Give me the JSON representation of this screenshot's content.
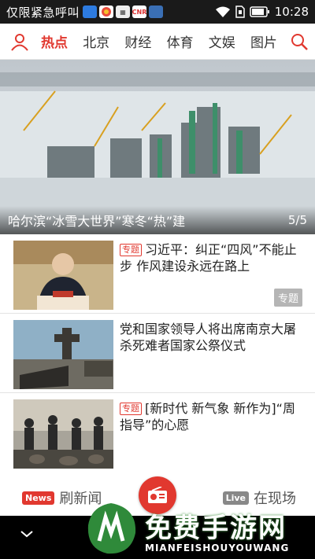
{
  "status_bar": {
    "carrier": "仅限紧急呼叫",
    "time": "10:28",
    "notification_icons": [
      {
        "name": "app-icon-blue",
        "text": "",
        "color": "#2d7be0"
      },
      {
        "name": "app-icon-color",
        "text": "",
        "color": "#e94b3c"
      },
      {
        "name": "app-icon-news",
        "text": "",
        "color": "#444"
      },
      {
        "name": "app-icon-cnr",
        "text": "CNR",
        "color": "#d33"
      },
      {
        "name": "app-icon-msg",
        "text": "",
        "color": "#3a6fb5"
      }
    ],
    "icons": [
      "wifi-icon",
      "sim-icon",
      "battery-icon"
    ]
  },
  "nav": {
    "tabs": [
      {
        "label": "热点",
        "active": true
      },
      {
        "label": "北京",
        "active": false
      },
      {
        "label": "财经",
        "active": false
      },
      {
        "label": "体育",
        "active": false
      },
      {
        "label": "文娱",
        "active": false
      },
      {
        "label": "图片",
        "active": false
      }
    ],
    "accent_color": "#e1382f"
  },
  "hero": {
    "caption": "哈尔滨“冰雪大世界”寒冬“热”建",
    "counter": "5/5"
  },
  "news": [
    {
      "tag": "专题",
      "title": "习近平：纠正“四风”不能止步 作风建设永远在路上",
      "badge": "专题"
    },
    {
      "tag": "",
      "title": "党和国家领导人将出席南京大屠杀死难者国家公祭仪式",
      "badge": ""
    },
    {
      "tag": "专题",
      "title": "[新时代 新气象 新作为]“周指导”的心愿",
      "badge": ""
    }
  ],
  "bottom_bar": {
    "left_pill": "News",
    "left_label": "刷新闻",
    "right_pill": "Live",
    "right_label": "在现场",
    "left_pill_color": "#e1382f",
    "right_pill_color": "#888888"
  },
  "watermark": {
    "title": "免费手游网",
    "subtitle": "MIANFEISHOUYOUWANG"
  }
}
